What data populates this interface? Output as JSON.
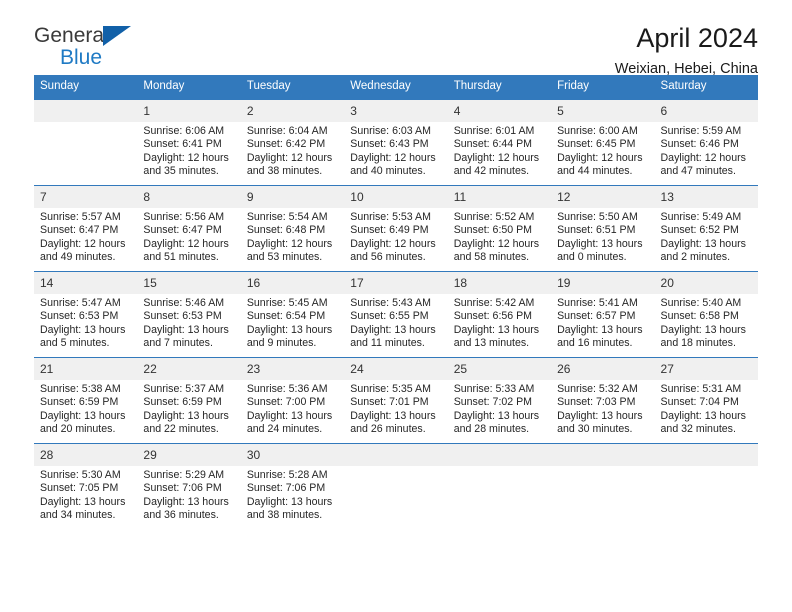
{
  "brand": {
    "name_part1": "General",
    "name_part2": "Blue"
  },
  "header": {
    "title": "April 2024",
    "subtitle": "Weixian, Hebei, China"
  },
  "calendar": {
    "weekday_headers": [
      "Sunday",
      "Monday",
      "Tuesday",
      "Wednesday",
      "Thursday",
      "Friday",
      "Saturday"
    ],
    "colors": {
      "header_blue": "#3279bc",
      "daynum_band": "#f0f0f0",
      "brand_blue": "#1f7ac4",
      "logo_triangle": "#1160a8"
    },
    "weeks": [
      [
        {
          "day": "",
          "lines": []
        },
        {
          "day": "1",
          "lines": [
            "Sunrise: 6:06 AM",
            "Sunset: 6:41 PM",
            "Daylight: 12 hours",
            "and 35 minutes."
          ]
        },
        {
          "day": "2",
          "lines": [
            "Sunrise: 6:04 AM",
            "Sunset: 6:42 PM",
            "Daylight: 12 hours",
            "and 38 minutes."
          ]
        },
        {
          "day": "3",
          "lines": [
            "Sunrise: 6:03 AM",
            "Sunset: 6:43 PM",
            "Daylight: 12 hours",
            "and 40 minutes."
          ]
        },
        {
          "day": "4",
          "lines": [
            "Sunrise: 6:01 AM",
            "Sunset: 6:44 PM",
            "Daylight: 12 hours",
            "and 42 minutes."
          ]
        },
        {
          "day": "5",
          "lines": [
            "Sunrise: 6:00 AM",
            "Sunset: 6:45 PM",
            "Daylight: 12 hours",
            "and 44 minutes."
          ]
        },
        {
          "day": "6",
          "lines": [
            "Sunrise: 5:59 AM",
            "Sunset: 6:46 PM",
            "Daylight: 12 hours",
            "and 47 minutes."
          ]
        }
      ],
      [
        {
          "day": "7",
          "lines": [
            "Sunrise: 5:57 AM",
            "Sunset: 6:47 PM",
            "Daylight: 12 hours",
            "and 49 minutes."
          ]
        },
        {
          "day": "8",
          "lines": [
            "Sunrise: 5:56 AM",
            "Sunset: 6:47 PM",
            "Daylight: 12 hours",
            "and 51 minutes."
          ]
        },
        {
          "day": "9",
          "lines": [
            "Sunrise: 5:54 AM",
            "Sunset: 6:48 PM",
            "Daylight: 12 hours",
            "and 53 minutes."
          ]
        },
        {
          "day": "10",
          "lines": [
            "Sunrise: 5:53 AM",
            "Sunset: 6:49 PM",
            "Daylight: 12 hours",
            "and 56 minutes."
          ]
        },
        {
          "day": "11",
          "lines": [
            "Sunrise: 5:52 AM",
            "Sunset: 6:50 PM",
            "Daylight: 12 hours",
            "and 58 minutes."
          ]
        },
        {
          "day": "12",
          "lines": [
            "Sunrise: 5:50 AM",
            "Sunset: 6:51 PM",
            "Daylight: 13 hours",
            "and 0 minutes."
          ]
        },
        {
          "day": "13",
          "lines": [
            "Sunrise: 5:49 AM",
            "Sunset: 6:52 PM",
            "Daylight: 13 hours",
            "and 2 minutes."
          ]
        }
      ],
      [
        {
          "day": "14",
          "lines": [
            "Sunrise: 5:47 AM",
            "Sunset: 6:53 PM",
            "Daylight: 13 hours",
            "and 5 minutes."
          ]
        },
        {
          "day": "15",
          "lines": [
            "Sunrise: 5:46 AM",
            "Sunset: 6:53 PM",
            "Daylight: 13 hours",
            "and 7 minutes."
          ]
        },
        {
          "day": "16",
          "lines": [
            "Sunrise: 5:45 AM",
            "Sunset: 6:54 PM",
            "Daylight: 13 hours",
            "and 9 minutes."
          ]
        },
        {
          "day": "17",
          "lines": [
            "Sunrise: 5:43 AM",
            "Sunset: 6:55 PM",
            "Daylight: 13 hours",
            "and 11 minutes."
          ]
        },
        {
          "day": "18",
          "lines": [
            "Sunrise: 5:42 AM",
            "Sunset: 6:56 PM",
            "Daylight: 13 hours",
            "and 13 minutes."
          ]
        },
        {
          "day": "19",
          "lines": [
            "Sunrise: 5:41 AM",
            "Sunset: 6:57 PM",
            "Daylight: 13 hours",
            "and 16 minutes."
          ]
        },
        {
          "day": "20",
          "lines": [
            "Sunrise: 5:40 AM",
            "Sunset: 6:58 PM",
            "Daylight: 13 hours",
            "and 18 minutes."
          ]
        }
      ],
      [
        {
          "day": "21",
          "lines": [
            "Sunrise: 5:38 AM",
            "Sunset: 6:59 PM",
            "Daylight: 13 hours",
            "and 20 minutes."
          ]
        },
        {
          "day": "22",
          "lines": [
            "Sunrise: 5:37 AM",
            "Sunset: 6:59 PM",
            "Daylight: 13 hours",
            "and 22 minutes."
          ]
        },
        {
          "day": "23",
          "lines": [
            "Sunrise: 5:36 AM",
            "Sunset: 7:00 PM",
            "Daylight: 13 hours",
            "and 24 minutes."
          ]
        },
        {
          "day": "24",
          "lines": [
            "Sunrise: 5:35 AM",
            "Sunset: 7:01 PM",
            "Daylight: 13 hours",
            "and 26 minutes."
          ]
        },
        {
          "day": "25",
          "lines": [
            "Sunrise: 5:33 AM",
            "Sunset: 7:02 PM",
            "Daylight: 13 hours",
            "and 28 minutes."
          ]
        },
        {
          "day": "26",
          "lines": [
            "Sunrise: 5:32 AM",
            "Sunset: 7:03 PM",
            "Daylight: 13 hours",
            "and 30 minutes."
          ]
        },
        {
          "day": "27",
          "lines": [
            "Sunrise: 5:31 AM",
            "Sunset: 7:04 PM",
            "Daylight: 13 hours",
            "and 32 minutes."
          ]
        }
      ],
      [
        {
          "day": "28",
          "lines": [
            "Sunrise: 5:30 AM",
            "Sunset: 7:05 PM",
            "Daylight: 13 hours",
            "and 34 minutes."
          ]
        },
        {
          "day": "29",
          "lines": [
            "Sunrise: 5:29 AM",
            "Sunset: 7:06 PM",
            "Daylight: 13 hours",
            "and 36 minutes."
          ]
        },
        {
          "day": "30",
          "lines": [
            "Sunrise: 5:28 AM",
            "Sunset: 7:06 PM",
            "Daylight: 13 hours",
            "and 38 minutes."
          ]
        },
        {
          "day": "",
          "lines": []
        },
        {
          "day": "",
          "lines": []
        },
        {
          "day": "",
          "lines": []
        },
        {
          "day": "",
          "lines": []
        }
      ]
    ]
  }
}
